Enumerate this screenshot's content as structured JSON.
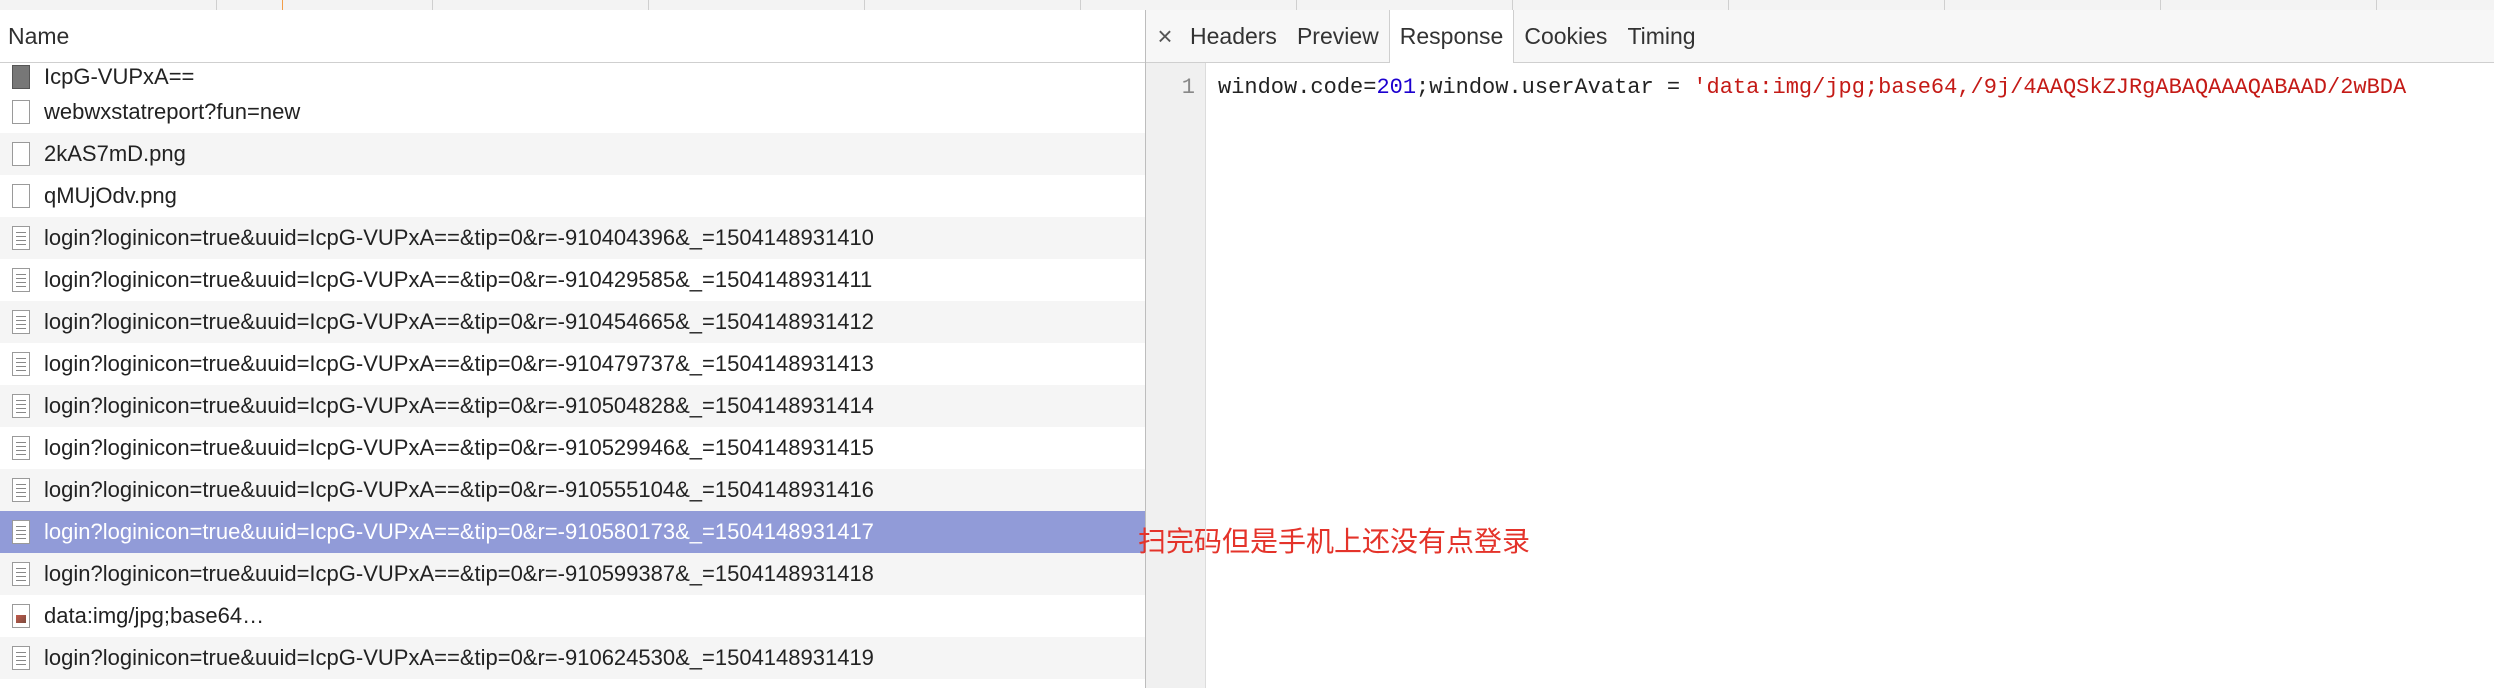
{
  "list_header": {
    "name": "Name"
  },
  "requests": [
    {
      "label": "IcpG-VUPxA==",
      "icon": "dark-file-icon"
    },
    {
      "label": "webwxstatreport?fun=new",
      "icon": "blank-file-icon"
    },
    {
      "label": "2kAS7mD.png",
      "icon": "blank-file-icon"
    },
    {
      "label": "qMUjOdv.png",
      "icon": "blank-file-icon"
    },
    {
      "label": "login?loginicon=true&uuid=IcpG-VUPxA==&tip=0&r=-910404396&_=1504148931410",
      "icon": "document-icon"
    },
    {
      "label": "login?loginicon=true&uuid=IcpG-VUPxA==&tip=0&r=-910429585&_=1504148931411",
      "icon": "document-icon"
    },
    {
      "label": "login?loginicon=true&uuid=IcpG-VUPxA==&tip=0&r=-910454665&_=1504148931412",
      "icon": "document-icon"
    },
    {
      "label": "login?loginicon=true&uuid=IcpG-VUPxA==&tip=0&r=-910479737&_=1504148931413",
      "icon": "document-icon"
    },
    {
      "label": "login?loginicon=true&uuid=IcpG-VUPxA==&tip=0&r=-910504828&_=1504148931414",
      "icon": "document-icon"
    },
    {
      "label": "login?loginicon=true&uuid=IcpG-VUPxA==&tip=0&r=-910529946&_=1504148931415",
      "icon": "document-icon"
    },
    {
      "label": "login?loginicon=true&uuid=IcpG-VUPxA==&tip=0&r=-910555104&_=1504148931416",
      "icon": "document-icon"
    },
    {
      "label": "login?loginicon=true&uuid=IcpG-VUPxA==&tip=0&r=-910580173&_=1504148931417",
      "icon": "document-icon",
      "selected": true
    },
    {
      "label": "login?loginicon=true&uuid=IcpG-VUPxA==&tip=0&r=-910599387&_=1504148931418",
      "icon": "document-icon"
    },
    {
      "label": "data:img/jpg;base64…",
      "icon": "image-icon"
    },
    {
      "label": "login?loginicon=true&uuid=IcpG-VUPxA==&tip=0&r=-910624530&_=1504148931419",
      "icon": "document-icon"
    }
  ],
  "detail_tabs": {
    "close": "×",
    "headers": "Headers",
    "preview": "Preview",
    "response": "Response",
    "cookies": "Cookies",
    "timing": "Timing"
  },
  "response": {
    "line_number": "1",
    "code_part1": "window.code=",
    "code_number": "201",
    "code_part2": ";window.userAvatar = ",
    "code_string": "'data:img/jpg;base64,/9j/4AAQSkZJRgABAQAAAQABAAD/2wBDA"
  },
  "annotation": "扫完码但是手机上还没有点登录",
  "colors": {
    "selected_row": "#919bd8",
    "annotation": "#e4332a",
    "code_number": "#1c00cf",
    "code_string": "#c41a16"
  }
}
